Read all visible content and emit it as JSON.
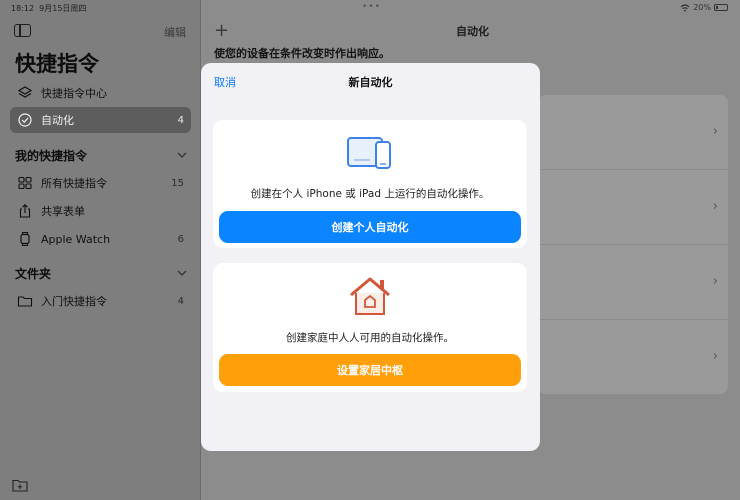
{
  "status_bar": {
    "time": "18:12",
    "date": "9月15日周四",
    "battery": "20%",
    "battery_level": 0.2
  },
  "sidebar": {
    "edit_label": "编辑",
    "title": "快捷指令",
    "items": [
      {
        "label": "快捷指令中心",
        "count": ""
      },
      {
        "label": "自动化",
        "count": "4"
      }
    ],
    "my_section": "我的快捷指令",
    "my_items": [
      {
        "label": "所有快捷指令",
        "count": "15"
      },
      {
        "label": "共享表单",
        "count": ""
      },
      {
        "label": "Apple Watch",
        "count": "6"
      }
    ],
    "folders_section": "文件夹",
    "folder_items": [
      {
        "label": "入门快捷指令",
        "count": "4"
      }
    ]
  },
  "main": {
    "title": "自动化",
    "description": "使您的设备在条件改变时作出响应。"
  },
  "modal": {
    "cancel_label": "取消",
    "title": "新自动化",
    "personal": {
      "description": "创建在个人 iPhone 或 iPad 上运行的自动化操作。",
      "button_label": "创建个人自动化"
    },
    "home": {
      "description": "创建家庭中人人可用的自动化操作。",
      "button_label": "设置家居中枢"
    }
  },
  "colors": {
    "accent_blue": "#0a84ff",
    "accent_orange": "#ff9f0a",
    "home_icon": "#d2573a"
  },
  "icons": {
    "personal": "ipad-iphone-icon",
    "home": "home-icon"
  }
}
